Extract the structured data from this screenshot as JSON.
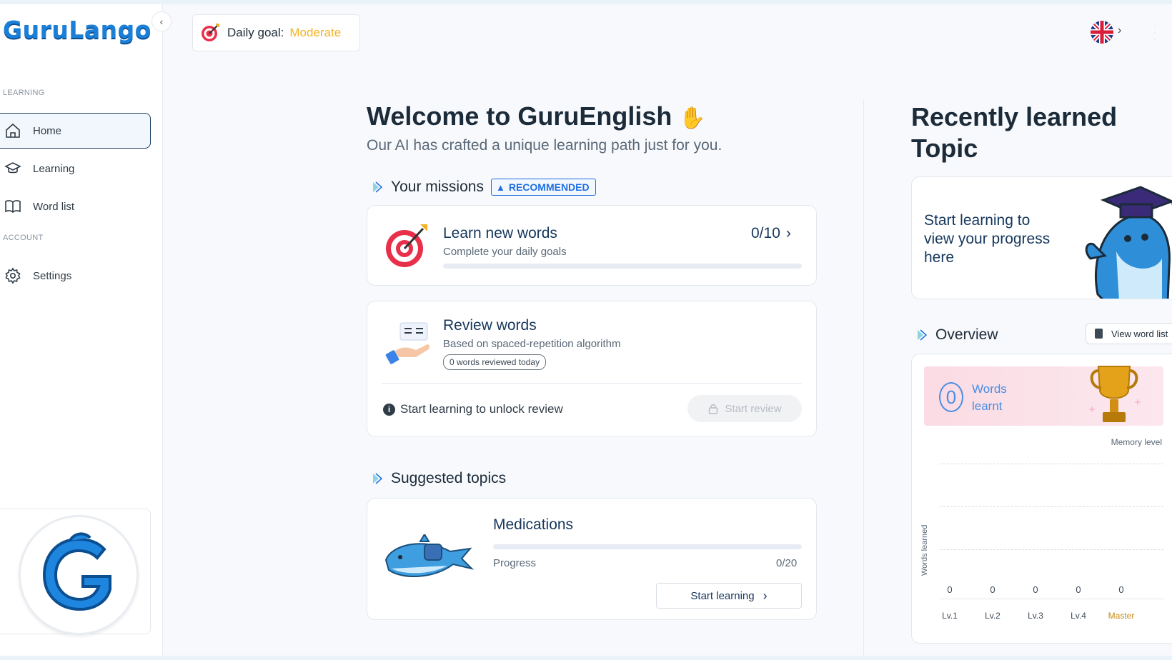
{
  "app": {
    "logo": "GuruLango"
  },
  "sidebar": {
    "section_learning": "LEARNING",
    "section_account": "ACCOUNT",
    "items": [
      {
        "label": "Home"
      },
      {
        "label": "Learning"
      },
      {
        "label": "Word list"
      },
      {
        "label": "Settings"
      }
    ]
  },
  "header": {
    "goal_label": "Daily goal:",
    "goal_value": "Moderate"
  },
  "main": {
    "title": "Welcome to GuruEnglish",
    "subtitle": "Our AI has crafted a unique learning path just for you.",
    "missions_heading": "Your missions",
    "recommended_badge": "RECOMMENDED",
    "learn_card": {
      "title": "Learn new words",
      "subtitle": "Complete your daily goals",
      "count": "0/10",
      "progress": 0
    },
    "review_card": {
      "title": "Review words",
      "subtitle": "Based on spaced-repetition algorithm",
      "pill": "0 words reviewed today",
      "info": "Start learning to unlock review",
      "button": "Start review"
    },
    "topics_heading": "Suggested topics",
    "topic_card": {
      "title": "Medications",
      "progress_label": "Progress",
      "progress_count": "0/20",
      "progress": 0,
      "button": "Start learning"
    }
  },
  "right": {
    "recent_title": "Recently learned Topic",
    "recent_text": "Start learning to view your progress here",
    "overview_heading": "Overview",
    "view_word_list": "View word list",
    "words_count": "0",
    "words_label": "Words learnt",
    "memory_label": "Memory level",
    "y_axis_label": "Words learned"
  },
  "chart_data": {
    "type": "bar",
    "categories": [
      "Lv.1",
      "Lv.2",
      "Lv.3",
      "Lv.4",
      "Master"
    ],
    "values": [
      0,
      0,
      0,
      0,
      0
    ],
    "title": "",
    "xlabel": "Memory level",
    "ylabel": "Words learned",
    "highlight_category": "Master",
    "highlight_color": "#c88a12"
  },
  "colors": {
    "accent": "#1f6fe0",
    "brand": "#1b7fd8",
    "goal": "#f5b323",
    "text_dark": "#16375c"
  }
}
